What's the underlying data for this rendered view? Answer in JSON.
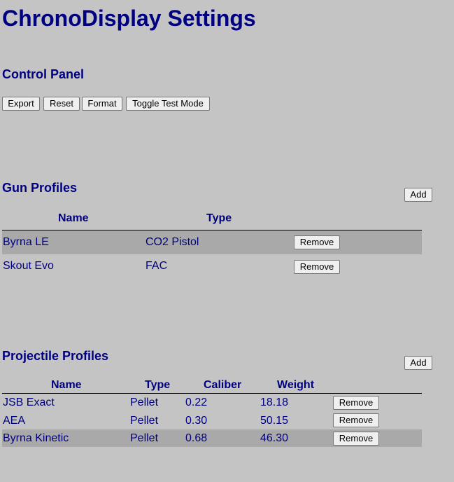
{
  "page": {
    "title": "ChronoDisplay Settings"
  },
  "control_panel": {
    "heading": "Control Panel",
    "buttons": {
      "export": "Export",
      "reset": "Reset",
      "format": "Format",
      "toggle_test": "Toggle Test Mode"
    }
  },
  "gun_profiles": {
    "heading": "Gun Profiles",
    "add_label": "Add",
    "columns": {
      "name": "Name",
      "type": "Type"
    },
    "rows": [
      {
        "name": "Byrna LE",
        "type": "CO2 Pistol",
        "remove": "Remove",
        "shaded": true
      },
      {
        "name": "Skout Evo",
        "type": "FAC",
        "remove": "Remove",
        "shaded": false
      }
    ]
  },
  "projectile_profiles": {
    "heading": "Projectile Profiles",
    "add_label": "Add",
    "columns": {
      "name": "Name",
      "type": "Type",
      "caliber": "Caliber",
      "weight": "Weight"
    },
    "rows": [
      {
        "name": "JSB Exact",
        "type": "Pellet",
        "caliber": "0.22",
        "weight": "18.18",
        "remove": "Remove",
        "shaded": false
      },
      {
        "name": "AEA",
        "type": "Pellet",
        "caliber": "0.30",
        "weight": "50.15",
        "remove": "Remove",
        "shaded": false
      },
      {
        "name": "Byrna Kinetic",
        "type": "Pellet",
        "caliber": "0.68",
        "weight": "46.30",
        "remove": "Remove",
        "shaded": true
      }
    ]
  },
  "colors": {
    "background": "#c4c4c4",
    "text": "#000080",
    "row_highlight": "#a9a9a9"
  }
}
